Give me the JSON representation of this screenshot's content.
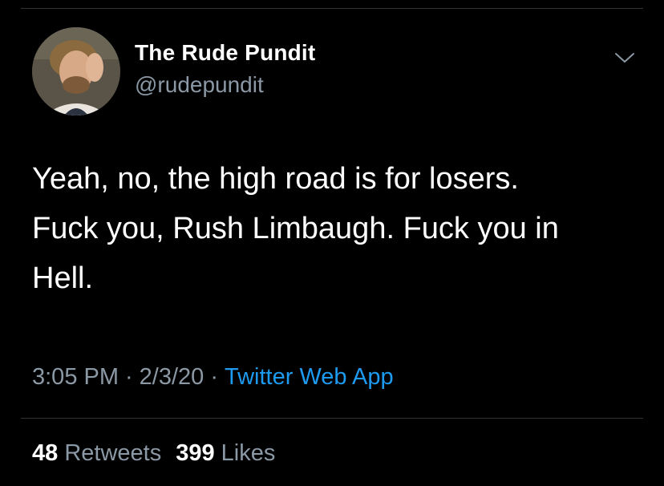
{
  "tweet": {
    "author": {
      "display_name": "The Rude Pundit",
      "handle": "@rudepundit"
    },
    "text_lines": [
      "Yeah, no, the high road is for losers.",
      "Fuck you, Rush Limbaugh. Fuck you in",
      "Hell."
    ],
    "time": "3:05 PM",
    "separator": "·",
    "date": "2/3/20",
    "source": "Twitter Web App",
    "stats": {
      "retweets_count": "48",
      "retweets_label": "Retweets",
      "likes_count": "399",
      "likes_label": "Likes"
    }
  },
  "colors": {
    "background": "#000000",
    "primary_text": "#ffffff",
    "secondary_text": "#8b98a5",
    "link": "#1d9bf0",
    "divider": "#2f3336"
  },
  "icons": {
    "more": "chevron-down-icon"
  }
}
